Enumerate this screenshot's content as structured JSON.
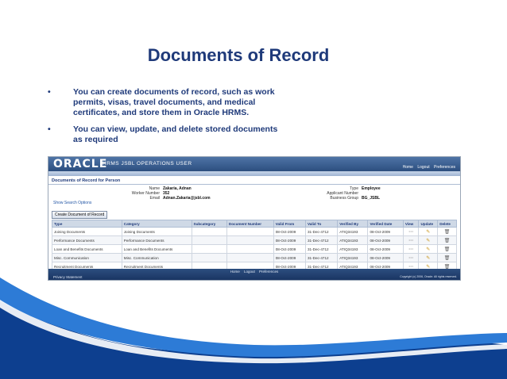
{
  "slide": {
    "title": "Documents of Record",
    "bullets": [
      "You can create documents of record, such as work permits, visas, travel documents, and medical certificates, and store them in Oracle HRMS.",
      "You can view, update, and delete stored documents as required"
    ],
    "bullet_glyph": "•"
  },
  "app": {
    "brand": "ORACLE",
    "app_name": "HRMS JSBL OPERATIONS USER",
    "global_nav": [
      "Home",
      "Logout",
      "Preferences"
    ],
    "page_heading": "Documents of Record for Person",
    "person": {
      "name_label": "Name",
      "name": "Zakaria, Adnan",
      "worker_label": "Worker Number",
      "worker": "352",
      "email_label": "Email",
      "email": "Adnan.Zakaria@jsbl.com",
      "type_label": "Type",
      "type": "Employee",
      "applicant_label": "Applicant Number",
      "applicant": "",
      "bg_label": "Business Group",
      "bg": "BG_JSBL"
    },
    "show_search": "Show Search Options",
    "create_button": "Create Document of Record",
    "columns": [
      "Type",
      "Category",
      "Subcategory",
      "Document Number",
      "Valid From",
      "Valid To",
      "Verified By",
      "Verified Date",
      "View",
      "Update",
      "Delete"
    ],
    "rows": [
      {
        "type": "Joining Documents",
        "category": "Joining Documents",
        "sub": "",
        "num": "",
        "from": "08-Oct-2009",
        "to": "31-Dec-4712",
        "by": "ATIQ34193",
        "date": "08-Oct-2009"
      },
      {
        "type": "Performance Documents",
        "category": "Performance Documents",
        "sub": "",
        "num": "",
        "from": "08-Oct-2009",
        "to": "31-Dec-4712",
        "by": "ATIQ34193",
        "date": "08-Oct-2009"
      },
      {
        "type": "Loan and Benefits Documents",
        "category": "Loan and Benefits Documents",
        "sub": "",
        "num": "",
        "from": "08-Oct-2009",
        "to": "31-Dec-4712",
        "by": "ATIQ34193",
        "date": "08-Oct-2009"
      },
      {
        "type": "Misc. Communication",
        "category": "Misc. Communication",
        "sub": "",
        "num": "",
        "from": "08-Oct-2009",
        "to": "31-Dec-4712",
        "by": "ATIQ34193",
        "date": "08-Oct-2009"
      },
      {
        "type": "Recruitment Documents",
        "category": "Recruitment Documents",
        "sub": "",
        "num": "",
        "from": "08-Oct-2009",
        "to": "31-Dec-4712",
        "by": "ATIQ34193",
        "date": "08-Oct-2009"
      }
    ],
    "footer_links": [
      "Home",
      "Logout",
      "Preferences"
    ],
    "privacy": "Privacy Statement",
    "copyright": "Copyright (c) 2006, Oracle. All rights reserved."
  },
  "colors": {
    "title_blue": "#1f3a7a",
    "oracle_bar": "#2c4e7f",
    "wave_dark": "#0d3f8f",
    "wave_light": "#2d7bd6"
  }
}
